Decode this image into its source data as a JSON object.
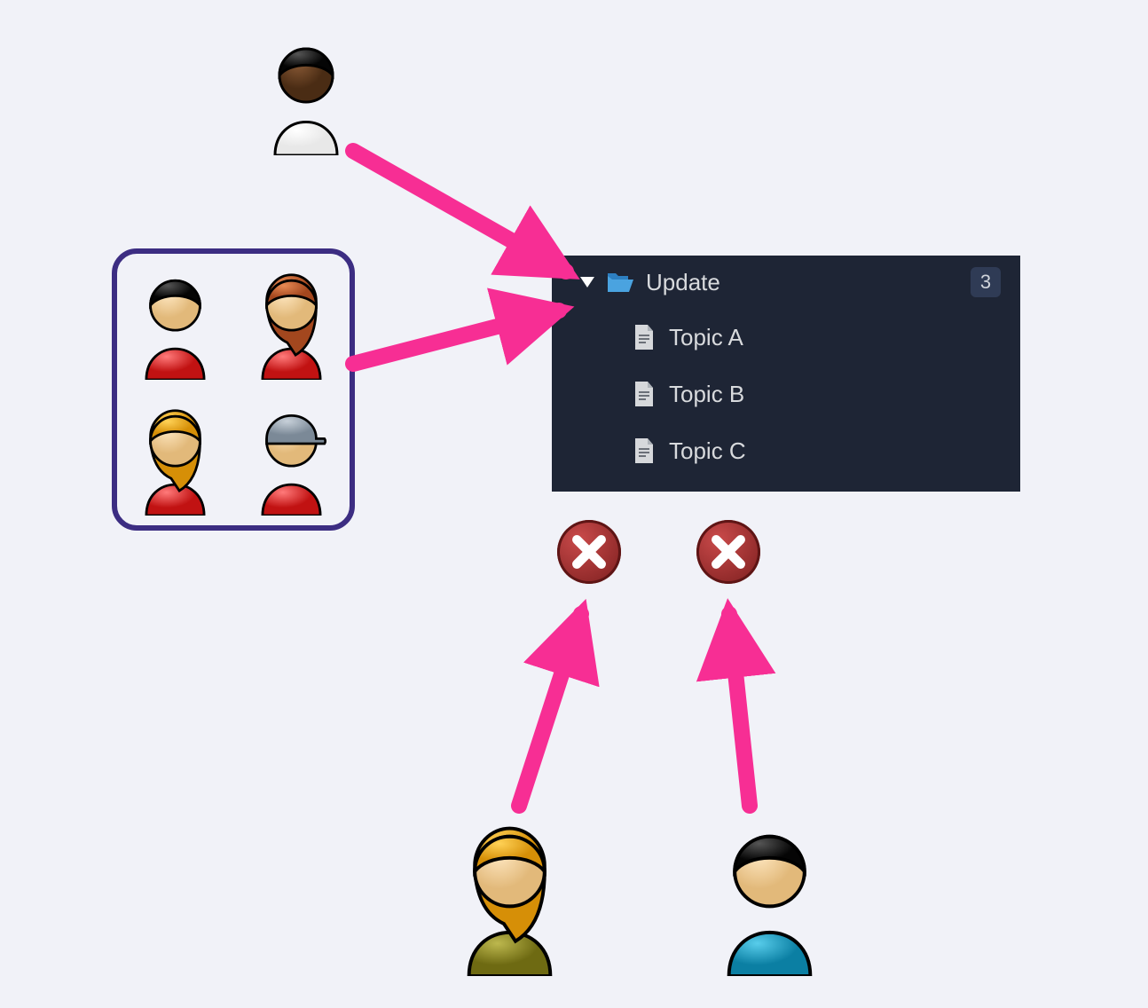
{
  "panel": {
    "folder_label": "Update",
    "badge": "3",
    "topics": [
      "Topic A",
      "Topic B",
      "Topic C"
    ]
  },
  "actors": {
    "owner": {
      "hair": "#1b1b1b",
      "skin": "#623c1e",
      "body": "#ffffff"
    },
    "group": [
      {
        "hair": "#1b1b1b",
        "skin": "#f3d29c",
        "body": "#e63131",
        "style": "short"
      },
      {
        "hair": "#c95c2e",
        "skin": "#f3d29c",
        "body": "#e63131",
        "style": "long"
      },
      {
        "hair": "#f1a80e",
        "skin": "#f3d29c",
        "body": "#e63131",
        "style": "long"
      },
      {
        "hair": "#8c9aa6",
        "skin": "#f3d29c",
        "body": "#e63131",
        "style": "cap"
      }
    ],
    "denied": [
      {
        "hair": "#f1a80e",
        "skin": "#f3d29c",
        "body": "#8f8a1e",
        "style": "long"
      },
      {
        "hair": "#1b1b1b",
        "skin": "#f3d29c",
        "body": "#17a3c7",
        "style": "short"
      }
    ]
  },
  "colors": {
    "arrow": "#f72e94",
    "panel_bg": "#1e2535",
    "border": "#3c2d82"
  }
}
